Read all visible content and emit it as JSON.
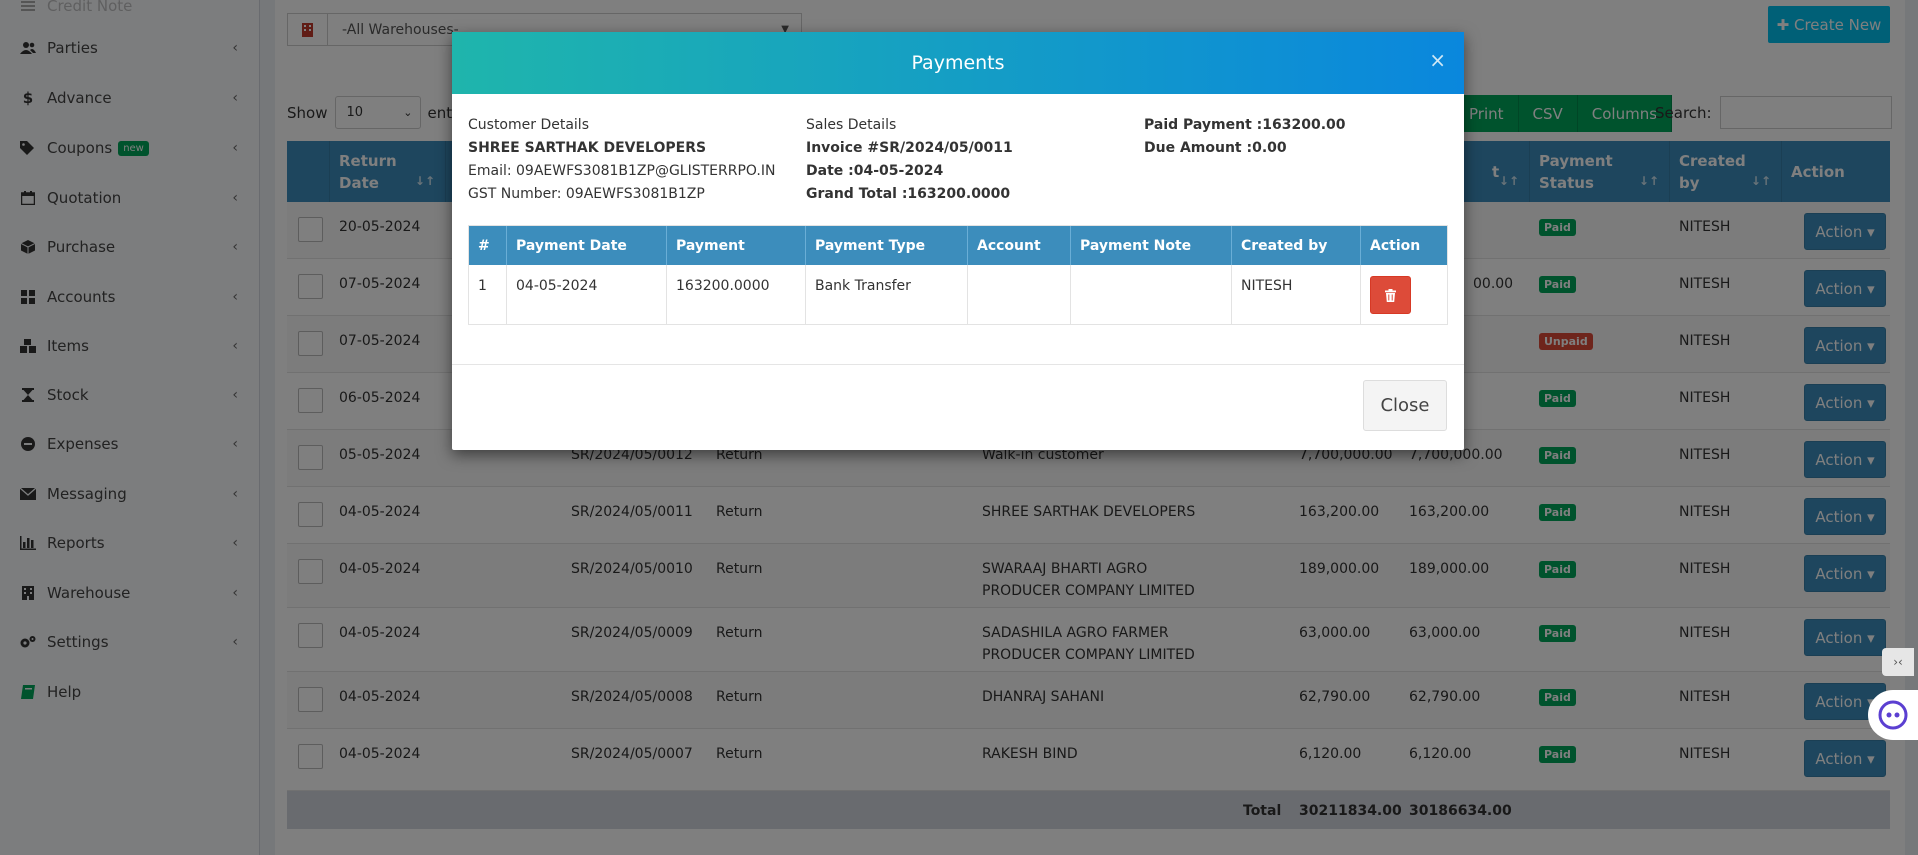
{
  "sidebar": {
    "items": [
      {
        "label": "Credit Note",
        "icon": "list-icon",
        "chevron": false
      },
      {
        "label": "Parties",
        "icon": "users-icon",
        "chevron": true
      },
      {
        "label": "Advance",
        "icon": "dollar-icon",
        "chevron": true
      },
      {
        "label": "Coupons",
        "icon": "tag-icon",
        "chevron": true,
        "badge": "new"
      },
      {
        "label": "Quotation",
        "icon": "calendar-icon",
        "chevron": true
      },
      {
        "label": "Purchase",
        "icon": "cube-icon",
        "chevron": true
      },
      {
        "label": "Accounts",
        "icon": "grid-icon",
        "chevron": true
      },
      {
        "label": "Items",
        "icon": "cubes-icon",
        "chevron": true
      },
      {
        "label": "Stock",
        "icon": "hourglass-icon",
        "chevron": true
      },
      {
        "label": "Expenses",
        "icon": "minus-circle-icon",
        "chevron": true
      },
      {
        "label": "Messaging",
        "icon": "envelope-icon",
        "chevron": true
      },
      {
        "label": "Reports",
        "icon": "bar-chart-icon",
        "chevron": true
      },
      {
        "label": "Warehouse",
        "icon": "building-icon",
        "chevron": true
      },
      {
        "label": "Settings",
        "icon": "gears-icon",
        "chevron": true
      },
      {
        "label": "Help",
        "icon": "book-icon",
        "chevron": false
      }
    ],
    "chevron_glyph": "‹"
  },
  "toolbar": {
    "warehouse_value": "-All Warehouses-",
    "create_new": "✚ Create New",
    "show_label": "Show",
    "entries_value": "10",
    "entries_label": "entrie",
    "buttons": [
      "Print",
      "CSV",
      "Columns"
    ],
    "search_label": "Search:"
  },
  "table": {
    "headers": {
      "return_date": "Return Date",
      "payment_status": "Payment Status",
      "created_by": "Created by",
      "action": "Action",
      "amount_partial": "t"
    },
    "sort_glyph": "↓↑",
    "rows": [
      {
        "date": "20-05-2024",
        "ref": "",
        "type": "",
        "customer": "",
        "total": "",
        "paid": "",
        "status": "Paid",
        "by": "NITESH"
      },
      {
        "date": "07-05-2024",
        "ref": "",
        "type": "",
        "customer": "",
        "total": "",
        "paid": "00.00",
        "status": "Paid",
        "by": "NITESH"
      },
      {
        "date": "07-05-2024",
        "ref": "",
        "type": "",
        "customer": "",
        "total": "",
        "paid": "",
        "status": "Unpaid",
        "by": "NITESH"
      },
      {
        "date": "06-05-2024",
        "ref": "",
        "type": "",
        "customer": "",
        "total": "",
        "paid": "",
        "status": "Paid",
        "by": "NITESH"
      },
      {
        "date": "05-05-2024",
        "ref": "SR/2024/05/0012",
        "type": "Return",
        "customer": "Walk-in customer",
        "total": "7,700,000.00",
        "paid": "7,700,000.00",
        "status": "Paid",
        "by": "NITESH"
      },
      {
        "date": "04-05-2024",
        "ref": "SR/2024/05/0011",
        "type": "Return",
        "customer": "SHREE SARTHAK DEVELOPERS",
        "total": "163,200.00",
        "paid": "163,200.00",
        "status": "Paid",
        "by": "NITESH"
      },
      {
        "date": "04-05-2024",
        "ref": "SR/2024/05/0010",
        "type": "Return",
        "customer": "SWARAAJ BHARTI AGRO PRODUCER COMPANY LIMITED",
        "total": "189,000.00",
        "paid": "189,000.00",
        "status": "Paid",
        "by": "NITESH"
      },
      {
        "date": "04-05-2024",
        "ref": "SR/2024/05/0009",
        "type": "Return",
        "customer": "SADASHILA AGRO FARMER PRODUCER COMPANY LIMITED",
        "total": "63,000.00",
        "paid": "63,000.00",
        "status": "Paid",
        "by": "NITESH"
      },
      {
        "date": "04-05-2024",
        "ref": "SR/2024/05/0008",
        "type": "Return",
        "customer": "DHANRAJ SAHANI",
        "total": "62,790.00",
        "paid": "62,790.00",
        "status": "Paid",
        "by": "NITESH"
      },
      {
        "date": "04-05-2024",
        "ref": "SR/2024/05/0007",
        "type": "Return",
        "customer": "RAKESH BIND",
        "total": "6,120.00",
        "paid": "6,120.00",
        "status": "Paid",
        "by": "NITESH"
      }
    ],
    "action_label": "Action ▾",
    "footer": {
      "label": "Total",
      "total": "30211834.00",
      "paid": "30186634.00"
    }
  },
  "modal": {
    "title": "Payments",
    "close_x": "×",
    "customer": {
      "heading": "Customer Details",
      "name": "SHREE SARTHAK DEVELOPERS",
      "email": "Email: 09AEWFS3081B1ZP@GLISTERRPO.IN",
      "gst": "GST Number: 09AEWFS3081B1ZP"
    },
    "sales": {
      "heading": "Sales Details",
      "invoice": "Invoice #SR/2024/05/0011",
      "date": "Date :04-05-2024",
      "grand_total": "Grand Total :163200.0000"
    },
    "summary": {
      "paid": "Paid Payment :163200.00",
      "due": "Due Amount :0.00"
    },
    "headers": [
      "#",
      "Payment Date",
      "Payment",
      "Payment Type",
      "Account",
      "Payment Note",
      "Created by",
      "Action"
    ],
    "rows": [
      {
        "num": "1",
        "date": "04-05-2024",
        "payment": "163200.0000",
        "type": "Bank Transfer",
        "account": "",
        "note": "",
        "by": "NITESH"
      }
    ],
    "close_button": "Close"
  },
  "colors": {
    "primary": "#3c8dbc",
    "success": "#00a65a",
    "danger": "#dd4b39",
    "header_gradient_start": "#1fb5ac",
    "header_gradient_end": "#0a87dd"
  }
}
